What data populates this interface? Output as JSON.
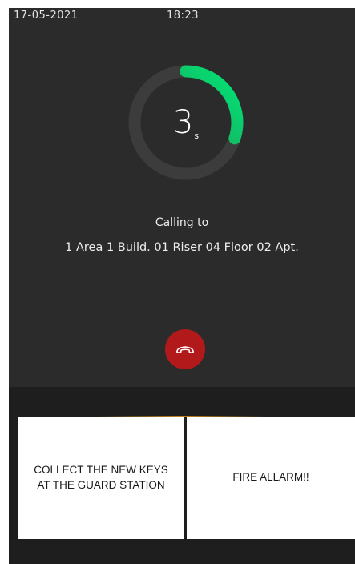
{
  "status_bar": {
    "date": "17-05-2021",
    "time": "18:23"
  },
  "countdown": {
    "value": "3",
    "unit": "s",
    "progress": 0.3
  },
  "call": {
    "label": "Calling to",
    "callee": "1 Area 1 Build. 01 Riser 04 Floor 02 Apt."
  },
  "hangup": {
    "icon": "phone-hangup-icon",
    "color": "#b1191a"
  },
  "messages": [
    {
      "text": "COLLECT THE NEW KEYS AT THE GUARD STATION"
    },
    {
      "text": "FIRE ALLARM!!"
    }
  ],
  "colors": {
    "background": "#2b2b2b",
    "ring_track": "#3c3c3c",
    "ring_progress": "#00e676",
    "accent": "#c5861c"
  }
}
